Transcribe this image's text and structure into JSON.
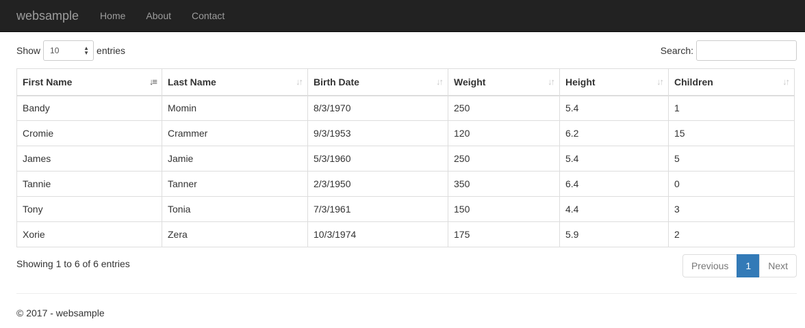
{
  "navbar": {
    "brand": "websample",
    "links": [
      "Home",
      "About",
      "Contact"
    ]
  },
  "length": {
    "label_before": "Show",
    "selected": "10",
    "label_after": "entries"
  },
  "search": {
    "label": "Search:",
    "value": "",
    "placeholder": ""
  },
  "table": {
    "columns": [
      "First Name",
      "Last Name",
      "Birth Date",
      "Weight",
      "Height",
      "Children"
    ],
    "sorted_column": "First Name",
    "sort_direction": "ascending",
    "rows": [
      [
        "Bandy",
        "Momin",
        "8/3/1970",
        "250",
        "5.4",
        "1"
      ],
      [
        "Cromie",
        "Crammer",
        "9/3/1953",
        "120",
        "6.2",
        "15"
      ],
      [
        "James",
        "Jamie",
        "5/3/1960",
        "250",
        "5.4",
        "5"
      ],
      [
        "Tannie",
        "Tanner",
        "2/3/1950",
        "350",
        "6.4",
        "0"
      ],
      [
        "Tony",
        "Tonia",
        "7/3/1961",
        "150",
        "4.4",
        "3"
      ],
      [
        "Xorie",
        "Zera",
        "10/3/1974",
        "175",
        "5.9",
        "2"
      ]
    ]
  },
  "info": "Showing 1 to 6 of 6 entries",
  "pagination": {
    "previous": "Previous",
    "current": "1",
    "next": "Next"
  },
  "footer": "© 2017 - websample",
  "colors": {
    "navbar_bg": "#222222",
    "accent": "#337ab7"
  }
}
